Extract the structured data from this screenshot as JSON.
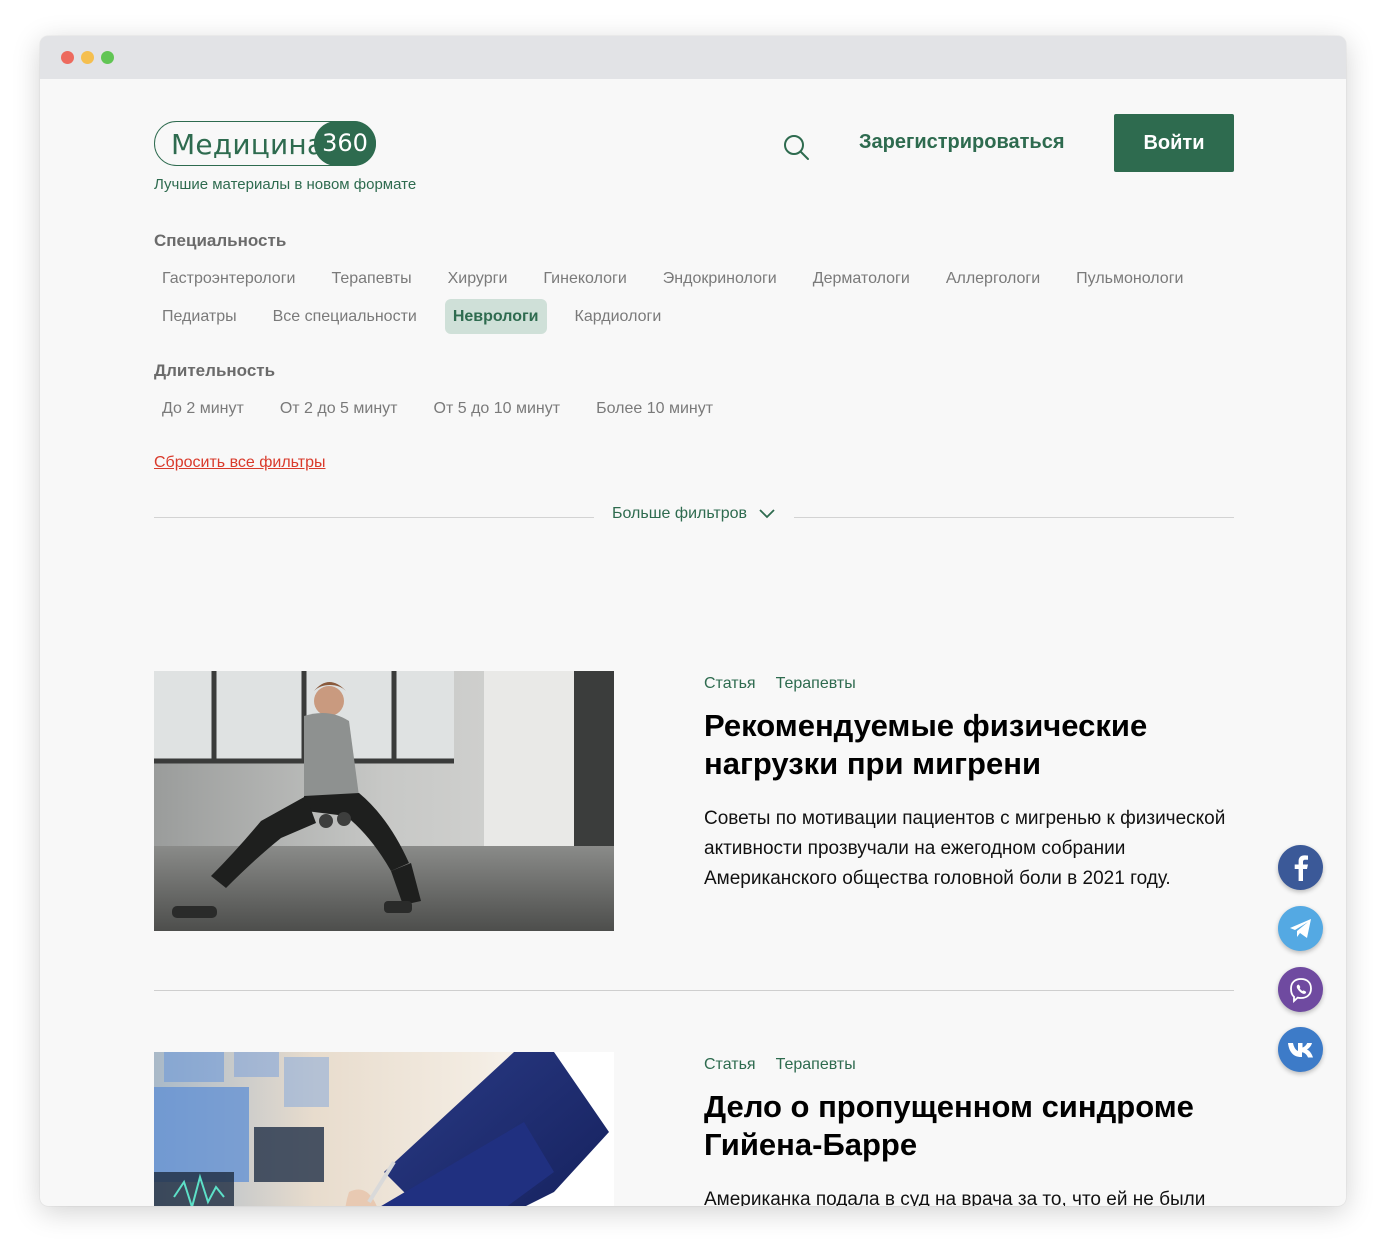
{
  "window": {
    "controls": [
      "close",
      "minimize",
      "maximize"
    ]
  },
  "header": {
    "logo_word": "Медицина",
    "logo_number": "360",
    "tagline": "Лучшие материалы в новом формате",
    "search_icon": "search-icon",
    "register_label": "Зарегистрироваться",
    "login_label": "Войти"
  },
  "filters": {
    "specialty": {
      "title": "Специальность",
      "row1": [
        "Гастроэнтерологи",
        "Терапевты",
        "Хирурги",
        "Гинекологи",
        "Эндокринологи",
        "Дерматологи",
        "Аллергологи",
        "Пульмонологи"
      ],
      "row2": [
        "Педиатры",
        "Все специальности",
        "Неврологи",
        "Кардиологи"
      ],
      "active": "Неврологи"
    },
    "duration": {
      "title": "Длительность",
      "options": [
        "До 2 минут",
        "От 2 до 5 минут",
        "От 5 до 10 минут",
        "Более 10 минут"
      ]
    },
    "reset_label": "Сбросить все фильтры",
    "more_label": "Больше фильтров"
  },
  "articles": [
    {
      "type": "Статья",
      "specialty": "Терапевты",
      "title": "Рекомендуемые физические нагрузки при мигрени",
      "excerpt": "Советы по мотивации пациентов с мигренью к физической активности прозвучали на ежегодном собрании Американского общества головной боли в 2021 году."
    },
    {
      "type": "Статья",
      "specialty": "Терапевты",
      "title": "Дело о пропущенном синдроме Гийена-Барре",
      "excerpt": "Американка подала в суд на врача за то, что ей не были"
    }
  ],
  "social": [
    "facebook-icon",
    "telegram-icon",
    "viber-icon",
    "vk-icon"
  ],
  "colors": {
    "brand": "#2e6b4f",
    "active_chip_bg": "#cfe0d8",
    "reset": "#d93a2b",
    "background": "#f8f8f8"
  }
}
